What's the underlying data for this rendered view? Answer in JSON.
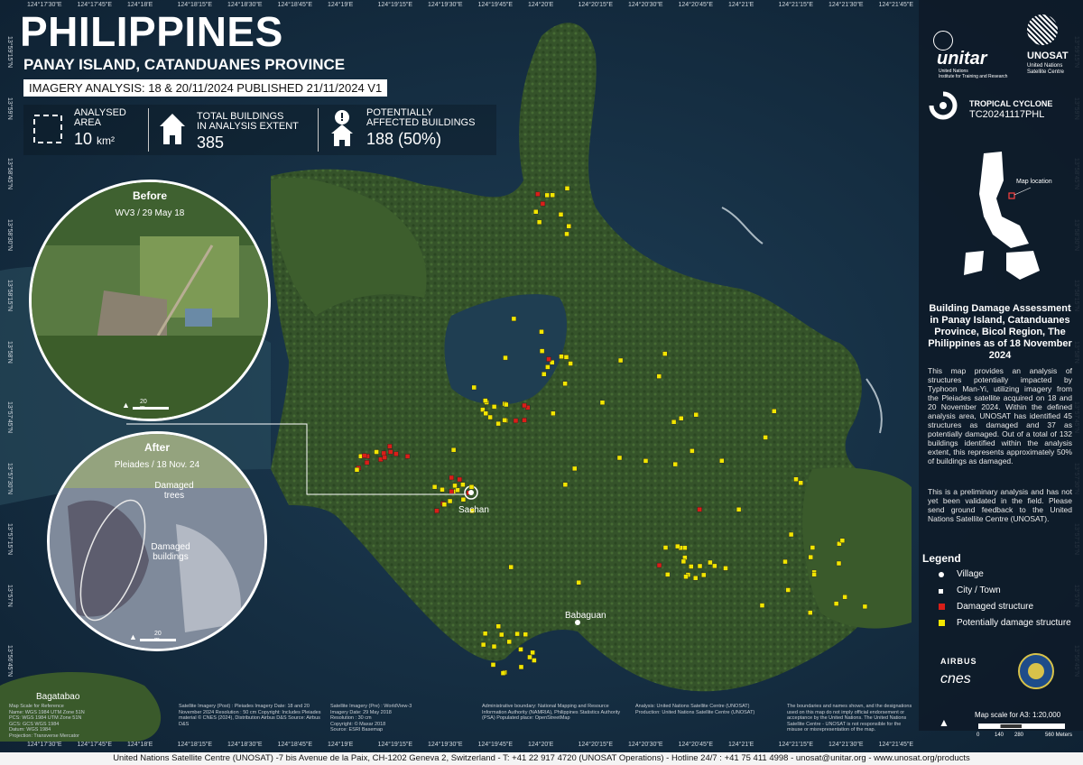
{
  "header": {
    "title": "PHILIPPINES",
    "subtitle": "PANAY ISLAND, CATANDUANES PROVINCE",
    "imagery": "IMAGERY ANALYSIS: 18 & 20/11/2024 PUBLISHED 21/11/2024 V1"
  },
  "stats": {
    "analysed_label_1": "ANALYSED",
    "analysed_label_2": "AREA",
    "analysed_value": "10",
    "analysed_unit": "km²",
    "total_label_1": "TOTAL BUILDINGS",
    "total_label_2": "IN ANALYSIS EXTENT",
    "total_value": "385",
    "affected_label_1": "POTENTIALLY",
    "affected_label_2": "AFFECTED BUILDINGS",
    "affected_value": "188 (50%)"
  },
  "before": {
    "title": "Before",
    "subtitle": "WV3 / 29 May 18",
    "scale": "20 m"
  },
  "after": {
    "title": "After",
    "subtitle": "Pleiades / 18 Nov. 24",
    "scale": "20 m",
    "annot_trees": "Damaged\ntrees",
    "annot_buildings": "Damaged\nbuildings"
  },
  "places": {
    "sachan": "Sachan",
    "babaguan": "Babaguan",
    "bagatabao": "Bagatabao"
  },
  "coords": {
    "top": [
      "124°17'30\"E",
      "124°17'45\"E",
      "124°18'E",
      "124°18'15\"E",
      "124°18'30\"E",
      "124°18'45\"E",
      "124°19'E",
      "124°19'15\"E",
      "124°19'30\"E",
      "124°19'45\"E",
      "124°20'E",
      "124°20'15\"E",
      "124°20'30\"E",
      "124°20'45\"E",
      "124°21'E",
      "124°21'15\"E",
      "124°21'30\"E",
      "124°21'45\"E"
    ],
    "left": [
      "13°59'15\"N",
      "13°59'N",
      "13°58'45\"N",
      "13°58'30\"N",
      "13°58'15\"N",
      "13°58'N",
      "13°57'45\"N",
      "13°57'30\"N",
      "13°57'15\"N",
      "13°57'N",
      "13°56'45\"N"
    ]
  },
  "side": {
    "unitar": "unitar",
    "unitar_sub": "United Nations\nInstitute for Training and Research",
    "unosat": "UNOSAT",
    "unosat_sub": "United Nations\nSatellite Centre",
    "cyclone_1": "TROPICAL CYCLONE",
    "cyclone_2": "TC20241117PHL",
    "map_location": "Map location",
    "heading": "Building Damage Assessment in Panay Island, Catanduanes Province, Bicol Region, The Philippines as of 18 November 2024",
    "body_1": "This map provides an analysis of structures potentially impacted by Typhoon Man-Yi, utilizing imagery from the Pleiades satellite acquired on 18 and 20 November 2024. Within the defined analysis area, UNOSAT has identified 45 structures as damaged and 37 as potentially damaged. Out of a total of 132 buildings identified within the analysis extent, this represents approximately 50% of buildings as damaged.",
    "body_2": "This is a preliminary analysis and has not yet been validated in the field. Please send ground feedback to the United Nations Satellite Centre (UNOSAT).",
    "legend_title": "Legend",
    "legend": [
      "Village",
      "City / Town",
      "Damaged structure",
      "Potentially damage structure"
    ],
    "airbus": "AIRBUS",
    "cnes": "cnes",
    "scale_title": "Map scale for A3: 1:20,000",
    "scale_ticks": [
      "0",
      "140",
      "280",
      "560 Meters"
    ]
  },
  "meta": {
    "col1": "Map Scale for Reference\nName: WGS 1984 UTM Zone 51N\nPCS: WGS 1984 UTM Zone 51N\nGCS: GCS WGS 1984\nDatum: WGS 1984\nProjection: Transverse Mercator",
    "col2": "Satellite Imagery (Post) : Pleiades\nImagery Date: 18 and 20 November 2024\nResolution : 50 cm\nCopyright: Includes Pleiades material © CNES (2024), Distribution Airbus D&S\nSource: Airbus D&S",
    "col3": "Satellite Imagery (Pre) : WorldView-3\nImagery Date: 29 May 2018\nResolution : 30 cm\nCopyright: © Maxar 2018\nSource: ESRI Basemap",
    "col4": "Administrative boundary: National Mapping and Resource Information Authority (NAMRIA), Philippines Statistics Authority (PSA)\nPopulated place: OpenStreetMap",
    "col5": "Analysis: United Nations Satellite Centre (UNOSAT)\nProduction: United Nations Satellite Centre (UNOSAT)",
    "col6": "The boundaries and names shown, and the designations used on this map do not imply official endorsement or acceptance by the United Nations. The United Nations Satellite Centre - UNOSAT is not responsible for the misuse or misrepresentation of the map."
  },
  "footer": "United Nations Satellite Centre (UNOSAT) -7 bis Avenue de la Paix, CH-1202 Geneva 2, Switzerland - T: +41 22 917 4720 (UNOSAT Operations) - Hotline 24/7 : +41 75 411 4998 - unosat@unitar.org - www.unosat.org/products",
  "colors": {
    "damaged": "#d91e18",
    "potential": "#f2e600",
    "sea": "#1b3a52",
    "land": "#3f5a2b"
  }
}
